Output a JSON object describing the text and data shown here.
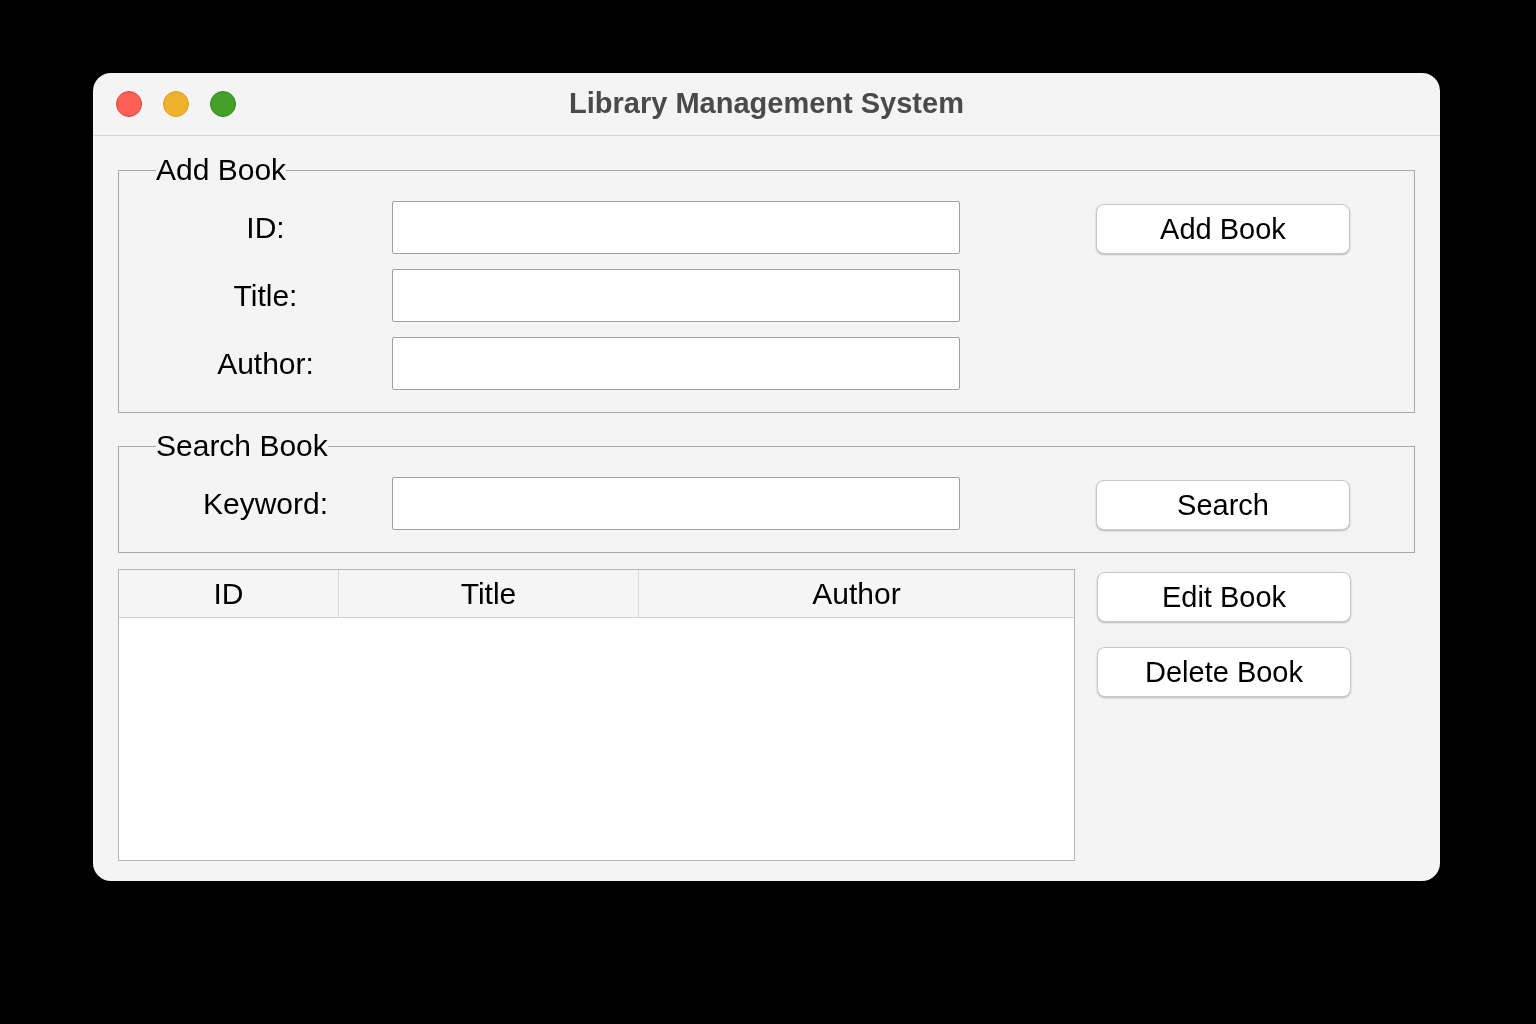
{
  "window": {
    "title": "Library Management System"
  },
  "add_book": {
    "legend": "Add Book",
    "fields": [
      {
        "label": "ID:"
      },
      {
        "label": "Title:"
      },
      {
        "label": "Author:"
      }
    ],
    "button": "Add Book"
  },
  "search_book": {
    "legend": "Search Book",
    "fields": [
      {
        "label": "Keyword:"
      }
    ],
    "button": "Search"
  },
  "table": {
    "columns": [
      "ID",
      "Title",
      "Author"
    ]
  },
  "side_buttons": [
    "Edit Book",
    "Delete Book"
  ]
}
